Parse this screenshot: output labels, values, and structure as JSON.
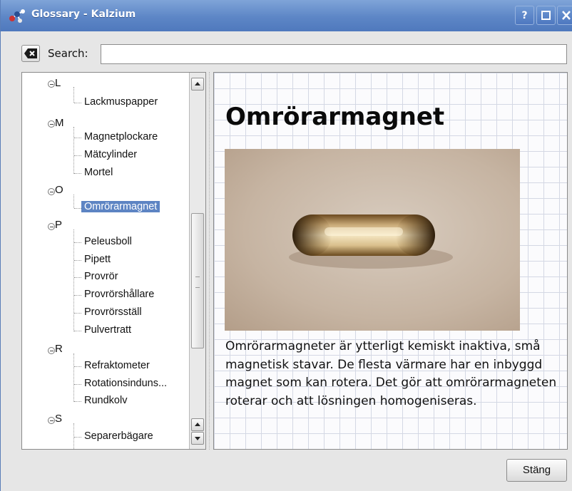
{
  "window": {
    "title": "Glossary - Kalzium",
    "help_button": "?",
    "maximize_icon": "maximize-icon",
    "close_icon": "close-icon"
  },
  "search": {
    "label": "Search:",
    "value": "",
    "placeholder": "",
    "clear_icon": "clear-left-icon"
  },
  "tree": {
    "groups": [
      {
        "label": "L",
        "items": [
          "Lackmuspapper"
        ]
      },
      {
        "label": "M",
        "items": [
          "Magnetplockare",
          "Mätcylinder",
          "Mortel"
        ]
      },
      {
        "label": "O",
        "items": [
          "Omrörarmagnet"
        ]
      },
      {
        "label": "P",
        "items": [
          "Peleusboll",
          "Pipett",
          "Provrör",
          "Provrörshållare",
          "Provrörsställ",
          "Pulvertratt"
        ]
      },
      {
        "label": "R",
        "items": [
          "Refraktometer",
          "Rotationsinduns...",
          "Rundkolv"
        ]
      },
      {
        "label": "S",
        "items": [
          "Separerbägare"
        ]
      }
    ],
    "selected": "Omrörarmagnet"
  },
  "content": {
    "title": "Omrörarmagnet",
    "image_subject": "stir-bar-photo",
    "description": "Omrörarmagneter är ytterligt kemiskt inaktiva, små magnetisk stavar. De flesta värmare har en inbyggd magnet som kan rotera. Det gör att omrörarmagneten roterar och att lösningen homogeniseras."
  },
  "buttons": {
    "close_label": "Stäng"
  },
  "colors": {
    "titlebar": "#5d86c6",
    "selection": "#5d84c3"
  }
}
